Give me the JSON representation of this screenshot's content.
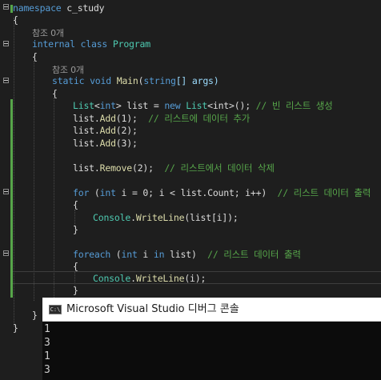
{
  "editor": {
    "ns_kw": "namespace",
    "ns_name": "c_study",
    "open_brace": "{",
    "close_brace": "}",
    "ref_count": "참조 0개",
    "internal_kw": "internal",
    "class_kw": "class",
    "class_name": "Program",
    "static_kw": "static",
    "void_kw": "void",
    "main_name": "Main",
    "string_kw": "string",
    "args_text": "[] args)",
    "paren_open": "(",
    "list_type": "List",
    "int_kw": "int",
    "line1_decl": "> list = ",
    "new_kw": "new",
    "line1_ctor": "<int>(); ",
    "comment1": "// 빈 리스트 생성",
    "list_add": "list.",
    "add_method": "Add",
    "arg1": "(1);  ",
    "comment2": "// 리스트에 데이터 추가",
    "arg2": "(2);",
    "arg3": "(3);",
    "remove_method": "Remove",
    "remove_arg": "(2);  ",
    "comment3": "// 리스트에서 데이터 삭제",
    "for_kw": "for",
    "for_rest": " (",
    "for_body": " i = 0; i < list.Count; i++)  ",
    "comment4": "// 리스트 데이터 출력",
    "console_type": "Console",
    "writeline": "WriteLine",
    "wl_arg_idx": "(list[i]);",
    "foreach_kw": "foreach",
    "in_kw": "in",
    "foreach_i": " i ",
    "foreach_list": " list)  ",
    "wl_arg_i": "(i);"
  },
  "console": {
    "title": "Microsoft Visual Studio 디버그 콘솔",
    "icon": "C:\\",
    "output": [
      "1",
      "3",
      "1",
      "3"
    ]
  }
}
